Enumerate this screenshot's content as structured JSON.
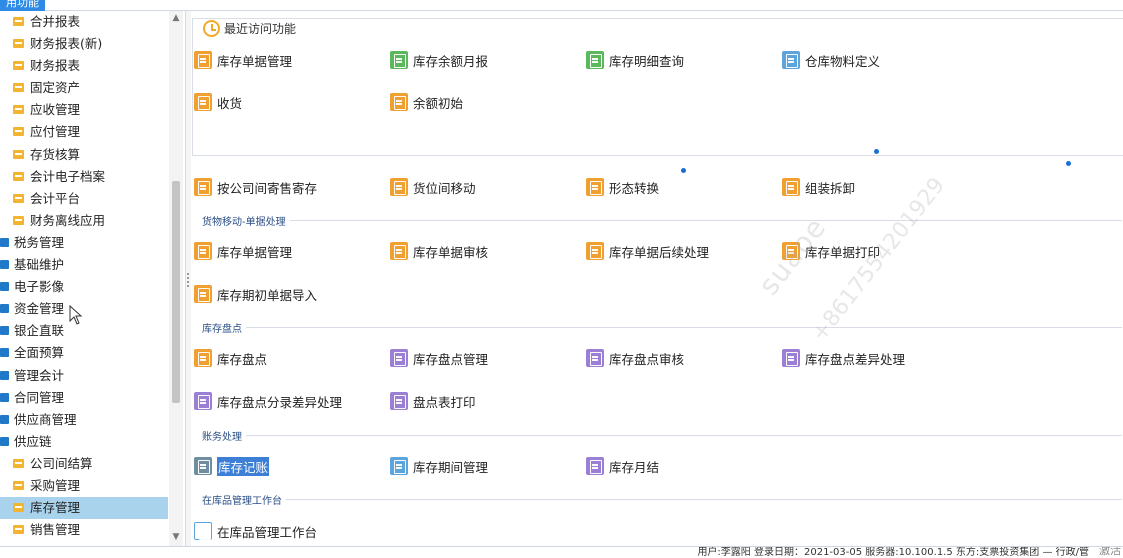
{
  "topbar": {
    "tab_label": "用功能"
  },
  "sidebar": {
    "items": [
      {
        "label": "合并报表",
        "level": 1
      },
      {
        "label": "财务报表(新)",
        "level": 1
      },
      {
        "label": "财务报表",
        "level": 1
      },
      {
        "label": "固定资产",
        "level": 1
      },
      {
        "label": "应收管理",
        "level": 1
      },
      {
        "label": "应付管理",
        "level": 1
      },
      {
        "label": "存货核算",
        "level": 1
      },
      {
        "label": "会计电子档案",
        "level": 1
      },
      {
        "label": "会计平台",
        "level": 1
      },
      {
        "label": "财务离线应用",
        "level": 1
      },
      {
        "label": "税务管理",
        "level": 0
      },
      {
        "label": "基础维护",
        "level": 0
      },
      {
        "label": "电子影像",
        "level": 0
      },
      {
        "label": "资金管理",
        "level": 0
      },
      {
        "label": "银企直联",
        "level": 0
      },
      {
        "label": "全面预算",
        "level": 0
      },
      {
        "label": "管理会计",
        "level": 0
      },
      {
        "label": "合同管理",
        "level": 0
      },
      {
        "label": "供应商管理",
        "level": 0
      },
      {
        "label": "供应链",
        "level": 0
      },
      {
        "label": "公司间结算",
        "level": 1
      },
      {
        "label": "采购管理",
        "level": 1
      },
      {
        "label": "库存管理",
        "level": 1,
        "selected": true
      },
      {
        "label": "销售管理",
        "level": 1
      }
    ]
  },
  "recent": {
    "title": "最近访问功能",
    "items": [
      {
        "label": "库存单据管理",
        "color": "#f0a030",
        "icon": "inventory-doc-icon"
      },
      {
        "label": "库存余额月报",
        "color": "#5cb85c",
        "icon": "balance-report-icon"
      },
      {
        "label": "库存明细查询",
        "color": "#5cb85c",
        "icon": "detail-query-icon"
      },
      {
        "label": "仓库物料定义",
        "color": "#5ba4dc",
        "icon": "cube-icon"
      },
      {
        "label": "收货",
        "color": "#f0a030",
        "icon": "receive-icon"
      },
      {
        "label": "余额初始",
        "color": "#f0a030",
        "icon": "balance-init-icon"
      }
    ]
  },
  "row_move": [
    {
      "label": "按公司间寄售寄存",
      "color": "#f0a030",
      "icon": "consign-icon"
    },
    {
      "label": "货位间移动",
      "color": "#f0a030",
      "icon": "location-move-icon"
    },
    {
      "label": "形态转换",
      "color": "#f0a030",
      "icon": "form-convert-icon"
    },
    {
      "label": "组装拆卸",
      "color": "#f0a030",
      "icon": "assembly-icon"
    }
  ],
  "sections": [
    {
      "title": "货物移动-单据处理",
      "items": [
        {
          "label": "库存单据管理",
          "color": "#f0a030",
          "icon": "inventory-doc-icon"
        },
        {
          "label": "库存单据审核",
          "color": "#f0a030",
          "icon": "doc-audit-icon"
        },
        {
          "label": "库存单据后续处理",
          "color": "#f0a030",
          "icon": "doc-followup-icon"
        },
        {
          "label": "库存单据打印",
          "color": "#f0a030",
          "icon": "doc-print-icon"
        },
        {
          "label": "库存期初单据导入",
          "color": "#f0a030",
          "icon": "doc-import-icon"
        }
      ]
    },
    {
      "title": "库存盘点",
      "items": [
        {
          "label": "库存盘点",
          "color": "#f0a030",
          "icon": "stocktake-icon"
        },
        {
          "label": "库存盘点管理",
          "color": "#9b7fd4",
          "icon": "stocktake-manage-icon"
        },
        {
          "label": "库存盘点审核",
          "color": "#9b7fd4",
          "icon": "stocktake-audit-icon"
        },
        {
          "label": "库存盘点差异处理",
          "color": "#9b7fd4",
          "icon": "stocktake-diff-icon"
        },
        {
          "label": "库存盘点分录差异处理",
          "color": "#9b7fd4",
          "icon": "stocktake-entry-diff-icon"
        },
        {
          "label": "盘点表打印",
          "color": "#9b7fd4",
          "icon": "stocktake-print-icon"
        }
      ]
    },
    {
      "title": "账务处理",
      "items": [
        {
          "label": "库存记账",
          "color": "#6f8fa0",
          "icon": "bookkeeping-icon",
          "highlighted": true
        },
        {
          "label": "库存期间管理",
          "color": "#5ba4dc",
          "icon": "period-manage-icon"
        },
        {
          "label": "库存月结",
          "color": "#9b7fd4",
          "icon": "month-close-icon"
        }
      ]
    },
    {
      "title": "在库品管理工作台",
      "items": [
        {
          "label": "在库品管理工作台",
          "color": "#5ba4dc",
          "icon": "cube-icon",
          "outline": true
        }
      ]
    }
  ],
  "watermark": {
    "line1": "suaoe",
    "line2": "+8617554201929"
  },
  "statusbar": {
    "text": "用户:李露阳  登录日期：2021-03-05  服务器:10.100.1.5  东方:支票投资集团  —  行政/管",
    "activate": "激活"
  }
}
